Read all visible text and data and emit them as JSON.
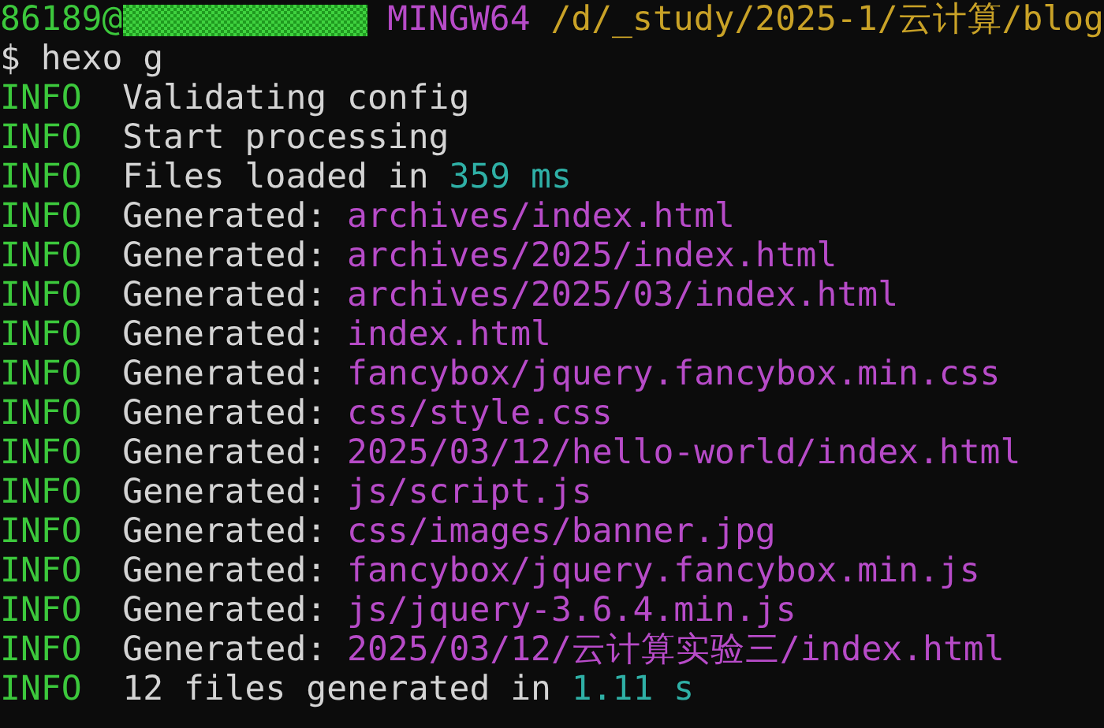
{
  "prompt": [
    {
      "kind": "user",
      "text": "86189@"
    },
    {
      "kind": "redacted"
    },
    {
      "kind": "host",
      "text": "MINGW64"
    },
    {
      "kind": "path",
      "text": "/d/_study/2025-1/云计算/blog"
    }
  ],
  "command": {
    "symbol": "$",
    "text": "hexo g"
  },
  "log": [
    {
      "level": "INFO",
      "parts": [
        {
          "kind": "plain",
          "text": "Validating config"
        }
      ]
    },
    {
      "level": "INFO",
      "parts": [
        {
          "kind": "plain",
          "text": "Start processing"
        }
      ]
    },
    {
      "level": "INFO",
      "parts": [
        {
          "kind": "plain",
          "text": "Files loaded in"
        },
        {
          "kind": "number",
          "text": "359 ms"
        }
      ]
    },
    {
      "level": "INFO",
      "parts": [
        {
          "kind": "plain",
          "text": "Generated:"
        },
        {
          "kind": "file",
          "text": "archives/index.html"
        }
      ]
    },
    {
      "level": "INFO",
      "parts": [
        {
          "kind": "plain",
          "text": "Generated:"
        },
        {
          "kind": "file",
          "text": "archives/2025/index.html"
        }
      ]
    },
    {
      "level": "INFO",
      "parts": [
        {
          "kind": "plain",
          "text": "Generated:"
        },
        {
          "kind": "file",
          "text": "archives/2025/03/index.html"
        }
      ]
    },
    {
      "level": "INFO",
      "parts": [
        {
          "kind": "plain",
          "text": "Generated:"
        },
        {
          "kind": "file",
          "text": "index.html"
        }
      ]
    },
    {
      "level": "INFO",
      "parts": [
        {
          "kind": "plain",
          "text": "Generated:"
        },
        {
          "kind": "file",
          "text": "fancybox/jquery.fancybox.min.css"
        }
      ]
    },
    {
      "level": "INFO",
      "parts": [
        {
          "kind": "plain",
          "text": "Generated:"
        },
        {
          "kind": "file",
          "text": "css/style.css"
        }
      ]
    },
    {
      "level": "INFO",
      "parts": [
        {
          "kind": "plain",
          "text": "Generated:"
        },
        {
          "kind": "file",
          "text": "2025/03/12/hello-world/index.html"
        }
      ]
    },
    {
      "level": "INFO",
      "parts": [
        {
          "kind": "plain",
          "text": "Generated:"
        },
        {
          "kind": "file",
          "text": "js/script.js"
        }
      ]
    },
    {
      "level": "INFO",
      "parts": [
        {
          "kind": "plain",
          "text": "Generated:"
        },
        {
          "kind": "file",
          "text": "css/images/banner.jpg"
        }
      ]
    },
    {
      "level": "INFO",
      "parts": [
        {
          "kind": "plain",
          "text": "Generated:"
        },
        {
          "kind": "file",
          "text": "fancybox/jquery.fancybox.min.js"
        }
      ]
    },
    {
      "level": "INFO",
      "parts": [
        {
          "kind": "plain",
          "text": "Generated:"
        },
        {
          "kind": "file",
          "text": "js/jquery-3.6.4.min.js"
        }
      ]
    },
    {
      "level": "INFO",
      "parts": [
        {
          "kind": "plain",
          "text": "Generated:"
        },
        {
          "kind": "file",
          "text": "2025/03/12/云计算实验三/index.html"
        }
      ]
    },
    {
      "level": "INFO",
      "parts": [
        {
          "kind": "plain",
          "text": "12 files generated in"
        },
        {
          "kind": "number",
          "text": "1.11 s"
        }
      ]
    }
  ]
}
